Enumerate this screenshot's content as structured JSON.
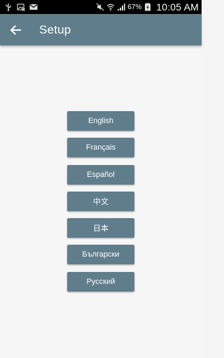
{
  "status_bar": {
    "icons": [
      "usb-icon",
      "image-crossed-icon",
      "gmail-icon",
      "mute-icon",
      "wifi-icon",
      "signal-icon",
      "battery-charging-icon"
    ],
    "battery_percent": "67%",
    "time": "10:05 AM"
  },
  "app_bar": {
    "back_icon": "arrow-left-icon",
    "title": "Setup",
    "color": "#607d8b"
  },
  "languages": [
    {
      "label": "English"
    },
    {
      "label": "Français"
    },
    {
      "label": "Español"
    },
    {
      "label": "中文"
    },
    {
      "label": "日本"
    },
    {
      "label": "Български"
    },
    {
      "label": "Русский"
    }
  ],
  "colors": {
    "button_bg": "#607d8b",
    "button_text": "#ffffff",
    "background": "#f6f6f6"
  }
}
